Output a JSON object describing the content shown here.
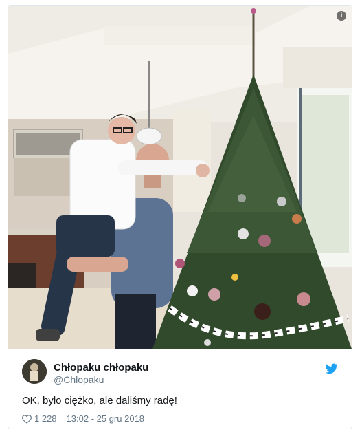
{
  "media": {
    "alt_icon": "info-icon"
  },
  "author": {
    "name": "Chłopaku chłopaku",
    "handle": "@Chlopaku",
    "avatar": "avatar-image"
  },
  "brand": {
    "icon": "twitter-bird-icon",
    "color": "#1da1f2"
  },
  "tweet": {
    "text": "OK, było ciężko, ale daliśmy radę!"
  },
  "stats": {
    "like_icon": "heart-icon",
    "likes": "1 228",
    "timestamp": "13:02 - 25 gru 2018"
  }
}
